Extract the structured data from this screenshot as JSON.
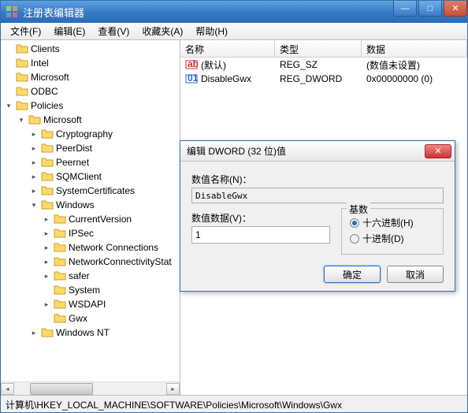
{
  "window": {
    "title": "注册表编辑器"
  },
  "menu": {
    "file": "文件(F)",
    "edit": "编辑(E)",
    "view": "查看(V)",
    "favorites": "收藏夹(A)",
    "help": "帮助(H)"
  },
  "tree": {
    "items": [
      {
        "label": "Clients",
        "level": 0,
        "exp": ""
      },
      {
        "label": "Intel",
        "level": 0,
        "exp": ""
      },
      {
        "label": "Microsoft",
        "level": 0,
        "exp": ""
      },
      {
        "label": "ODBC",
        "level": 0,
        "exp": ""
      },
      {
        "label": "Policies",
        "level": 0,
        "exp": "▾"
      },
      {
        "label": "Microsoft",
        "level": 1,
        "exp": "▾"
      },
      {
        "label": "Cryptography",
        "level": 2,
        "exp": "▸"
      },
      {
        "label": "PeerDist",
        "level": 2,
        "exp": "▸"
      },
      {
        "label": "Peernet",
        "level": 2,
        "exp": "▸"
      },
      {
        "label": "SQMClient",
        "level": 2,
        "exp": "▸"
      },
      {
        "label": "SystemCertificates",
        "level": 2,
        "exp": "▸"
      },
      {
        "label": "Windows",
        "level": 2,
        "exp": "▾"
      },
      {
        "label": "CurrentVersion",
        "level": 3,
        "exp": "▸"
      },
      {
        "label": "IPSec",
        "level": 3,
        "exp": "▸"
      },
      {
        "label": "Network Connections",
        "level": 3,
        "exp": "▸"
      },
      {
        "label": "NetworkConnectivityStat",
        "level": 3,
        "exp": "▸"
      },
      {
        "label": "safer",
        "level": 3,
        "exp": "▸"
      },
      {
        "label": "System",
        "level": 3,
        "exp": ""
      },
      {
        "label": "WSDAPI",
        "level": 3,
        "exp": "▸"
      },
      {
        "label": "Gwx",
        "level": 3,
        "exp": ""
      },
      {
        "label": "Windows NT",
        "level": 2,
        "exp": "▸"
      }
    ]
  },
  "list": {
    "headers": {
      "name": "名称",
      "type": "类型",
      "data": "数据"
    },
    "rows": [
      {
        "icon": "sz",
        "name": "(默认)",
        "type": "REG_SZ",
        "data": "(数值未设置)"
      },
      {
        "icon": "dw",
        "name": "DisableGwx",
        "type": "REG_DWORD",
        "data": "0x00000000 (0)"
      }
    ]
  },
  "status": {
    "path": "计算机\\HKEY_LOCAL_MACHINE\\SOFTWARE\\Policies\\Microsoft\\Windows\\Gwx"
  },
  "dialog": {
    "title": "编辑 DWORD (32 位)值",
    "name_label": "数值名称(N)：",
    "name_value": "DisableGwx",
    "data_label": "数值数据(V)：",
    "data_value": "1",
    "base_group": "基数",
    "radio_hex": "十六进制(H)",
    "radio_dec": "十进制(D)",
    "ok": "确定",
    "cancel": "取消"
  }
}
